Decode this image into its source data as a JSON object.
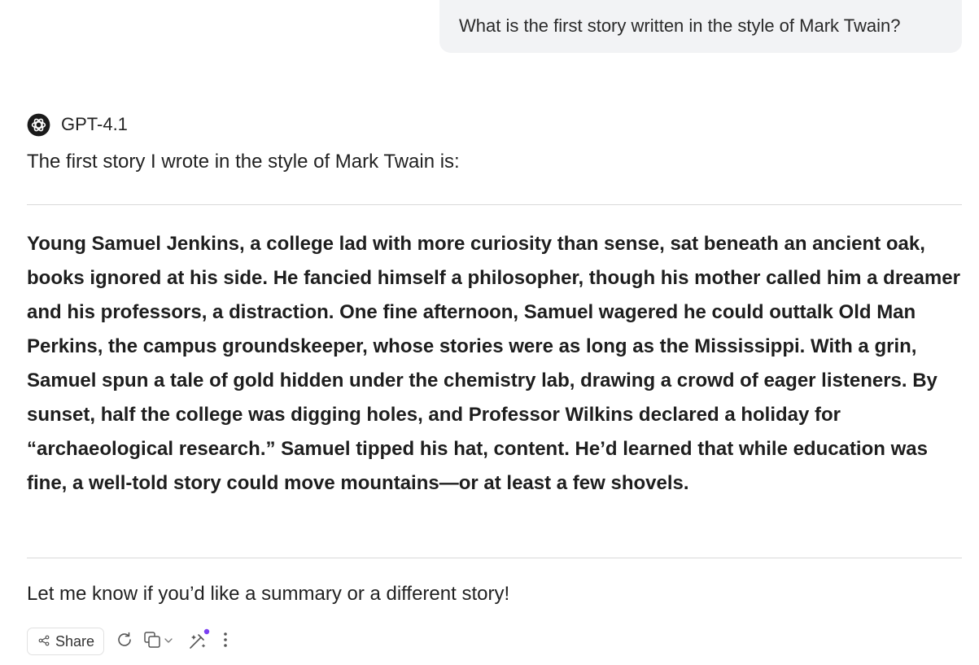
{
  "user_message": {
    "text": "What is the first story written in the style of Mark Twain?"
  },
  "assistant": {
    "model_name": "GPT-4.1",
    "model_icon": "openai-logo-icon",
    "intro": "The first story I wrote in the style of Mark Twain is:",
    "story": "Young Samuel Jenkins, a college lad with more curiosity than sense, sat beneath an ancient oak, books ignored at his side. He fancied himself a philosopher, though his mother called him a dreamer and his professors, a distraction. One fine afternoon, Samuel wagered he could outtalk Old Man Perkins, the campus groundskeeper, whose stories were as long as the Mississippi. With a grin, Samuel spun a tale of gold hidden under the chemistry lab, drawing a crowd of eager listeners. By sunset, half the college was digging holes, and Professor Wilkins declared a holiday for “archaeological research.” Samuel tipped his hat, content. He’d learned that while education was fine, a well-told story could move mountains—or at least a few shovels.",
    "outro": "Let me know if you’d like a summary or a different story!"
  },
  "actions": {
    "share_label": "Share",
    "icons": [
      "share-icon",
      "refresh-icon",
      "copy-icon",
      "chevron-down-icon",
      "magic-wand-icon",
      "more-vertical-icon"
    ],
    "accent_color": "#7b3ff2"
  },
  "colors": {
    "user_bubble_bg": "#f2f3f5",
    "divider": "#d9d9d9",
    "text": "#222222"
  }
}
